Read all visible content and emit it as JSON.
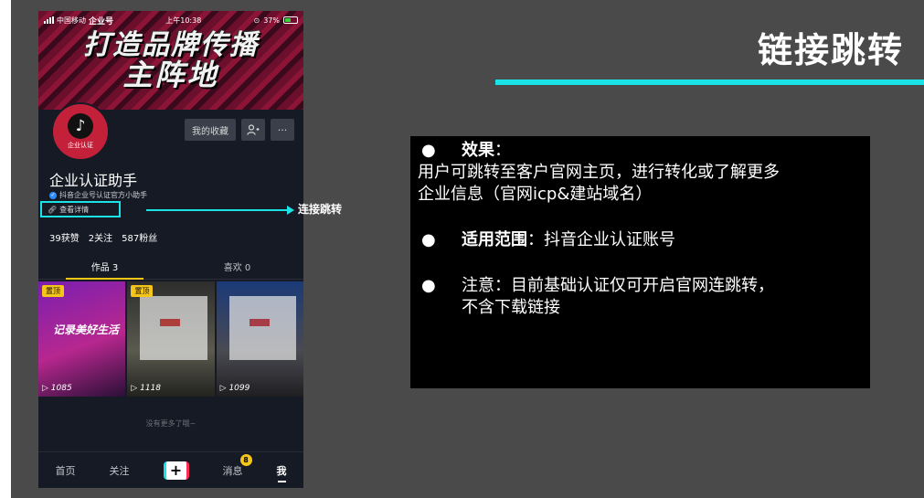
{
  "slide": {
    "title": "链接跳转",
    "accent_color": "#19e3e6",
    "arrow_label": "连接跳转"
  },
  "phone": {
    "status": {
      "carrier": "中国移动",
      "app_badge": "企业号",
      "time": "上午10:38",
      "battery": "37%"
    },
    "banner": {
      "line1": "打造品牌传播",
      "line2": "主阵地"
    },
    "avatar_label": "企业认证",
    "actions": {
      "favorites": "我的收藏",
      "add_friend_icon": "add-user-icon",
      "more": "···"
    },
    "name": "企业认证助手",
    "verify_text": "抖音企业号认证官方小助手",
    "detail_link": "查看详情",
    "stats": {
      "likes": "39获赞",
      "following": "2关注",
      "fans": "587粉丝"
    },
    "tabs": [
      "作品 3",
      "喜欢 0"
    ],
    "videos": [
      {
        "pin": "置顶",
        "caption": "记录美好生活",
        "views": "1085"
      },
      {
        "pin": "置顶",
        "caption": "",
        "views": "1118"
      },
      {
        "pin": "",
        "caption": "",
        "views": "1099"
      }
    ],
    "no_more": "没有更多了哦~",
    "nav": {
      "home": "首页",
      "follow": "关注",
      "plus": "+",
      "messages": "消息",
      "messages_badge": "8",
      "me": "我"
    }
  },
  "info": {
    "item1_title": "效果",
    "item1_colon": "：",
    "item1_body_l1": "用户可跳转至客户官网主页，进行转化或了解更多",
    "item1_body_l2": "企业信息（官网icp&建站域名）",
    "item2_title": "适用范围",
    "item2_body": "：抖音企业认证账号",
    "item3_l1": "注意：目前基础认证仅可开启官网连跳转，",
    "item3_l2": "不含下载链接"
  }
}
